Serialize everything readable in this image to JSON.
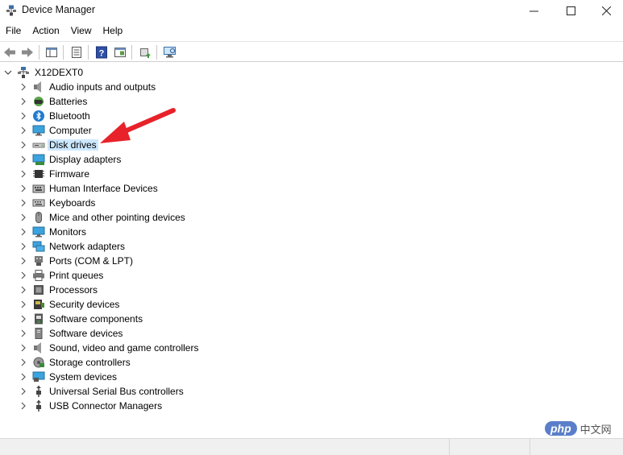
{
  "window": {
    "title": "Device Manager"
  },
  "menu": [
    "File",
    "Action",
    "View",
    "Help"
  ],
  "toolbar": [
    "back-icon",
    "forward-icon",
    "properties-pane-icon",
    "list-view-icon",
    "help-icon",
    "show-hide-icon",
    "update-driver-icon",
    "scan-hardware-icon"
  ],
  "tree": {
    "root": "X12DEXT0",
    "items": [
      {
        "label": "Audio inputs and outputs",
        "icon": "speaker-icon"
      },
      {
        "label": "Batteries",
        "icon": "battery-icon"
      },
      {
        "label": "Bluetooth",
        "icon": "bluetooth-icon"
      },
      {
        "label": "Computer",
        "icon": "computer-icon"
      },
      {
        "label": "Disk drives",
        "icon": "disk-drive-icon",
        "selected": true
      },
      {
        "label": "Display adapters",
        "icon": "display-adapter-icon"
      },
      {
        "label": "Firmware",
        "icon": "firmware-icon"
      },
      {
        "label": "Human Interface Devices",
        "icon": "hid-icon"
      },
      {
        "label": "Keyboards",
        "icon": "keyboard-icon"
      },
      {
        "label": "Mice and other pointing devices",
        "icon": "mouse-icon"
      },
      {
        "label": "Monitors",
        "icon": "monitor-icon"
      },
      {
        "label": "Network adapters",
        "icon": "network-adapter-icon"
      },
      {
        "label": "Ports (COM & LPT)",
        "icon": "port-icon"
      },
      {
        "label": "Print queues",
        "icon": "printer-icon"
      },
      {
        "label": "Processors",
        "icon": "processor-icon"
      },
      {
        "label": "Security devices",
        "icon": "security-device-icon"
      },
      {
        "label": "Software components",
        "icon": "software-component-icon"
      },
      {
        "label": "Software devices",
        "icon": "software-device-icon"
      },
      {
        "label": "Sound, video and game controllers",
        "icon": "sound-controller-icon"
      },
      {
        "label": "Storage controllers",
        "icon": "storage-controller-icon"
      },
      {
        "label": "System devices",
        "icon": "system-device-icon"
      },
      {
        "label": "Universal Serial Bus controllers",
        "icon": "usb-icon"
      },
      {
        "label": "USB Connector Managers",
        "icon": "usb-connector-icon"
      }
    ]
  },
  "annotation": {
    "arrow_color": "#e8222a"
  },
  "watermark": {
    "brand": "php",
    "text": "中文网"
  },
  "colors": {
    "selection": "#cce8ff"
  }
}
